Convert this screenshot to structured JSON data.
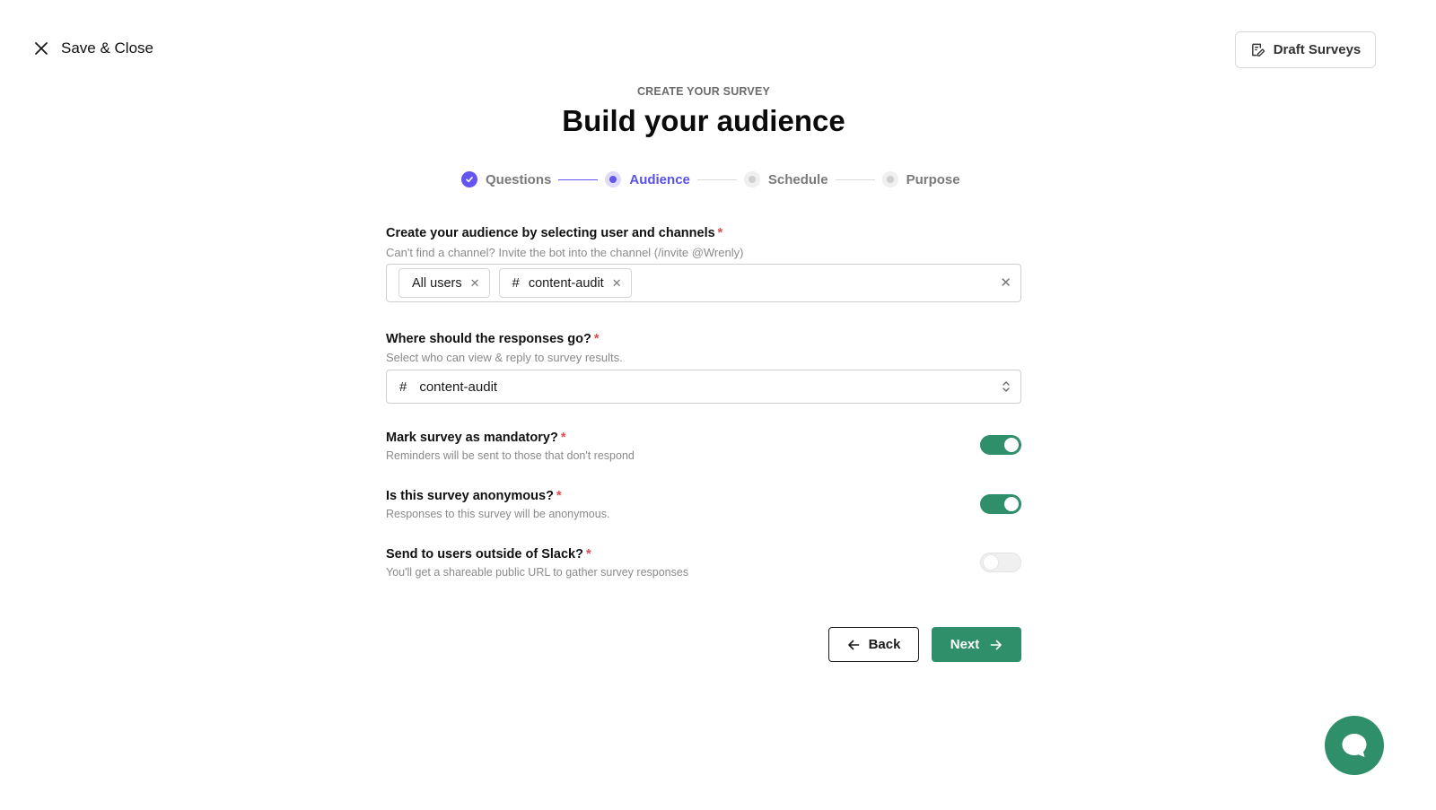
{
  "header": {
    "save_close_label": "Save & Close",
    "draft_surveys_label": "Draft Surveys"
  },
  "hero": {
    "eyebrow": "CREATE YOUR SURVEY",
    "title": "Build your audience"
  },
  "stepper": {
    "steps": [
      {
        "label": "Questions",
        "state": "complete"
      },
      {
        "label": "Audience",
        "state": "active"
      },
      {
        "label": "Schedule",
        "state": "upcoming"
      },
      {
        "label": "Purpose",
        "state": "upcoming"
      }
    ]
  },
  "audience": {
    "label": "Create your audience by selecting user and channels",
    "required_mark": "*",
    "hint": "Can't find a channel? Invite the bot into the channel (/invite @Wrenly)",
    "chips": [
      {
        "label": "All users",
        "prefix": ""
      },
      {
        "label": "content-audit",
        "prefix": "#"
      }
    ]
  },
  "responses": {
    "label": "Where should the responses go?",
    "required_mark": "*",
    "hint": "Select who can view & reply to survey results.",
    "selected_prefix": "#",
    "selected_value": "content-audit"
  },
  "toggles": {
    "mandatory": {
      "label": "Mark survey as mandatory?",
      "required_mark": "*",
      "hint": "Reminders will be sent to those that don't respond",
      "on": true
    },
    "anonymous": {
      "label": "Is this survey anonymous?",
      "required_mark": "*",
      "hint": "Responses to this survey will be anonymous.",
      "on": true
    },
    "outside_slack": {
      "label": "Send to users outside of Slack?",
      "required_mark": "*",
      "hint": "You'll get a shareable public URL to gather survey responses",
      "on": false
    }
  },
  "actions": {
    "back_label": "Back",
    "next_label": "Next"
  },
  "colors": {
    "accent_purple": "#6356f0",
    "accent_green": "#2f8f6a",
    "required_red": "#e5484d"
  },
  "icons": {
    "close": "close-icon",
    "draft": "edit-document-icon",
    "check": "check-icon",
    "hash": "hash-icon",
    "chevron": "chevron-up-down-icon",
    "arrow_left": "arrow-left-icon",
    "arrow_right": "arrow-right-icon",
    "chat": "chat-bubble-icon"
  }
}
